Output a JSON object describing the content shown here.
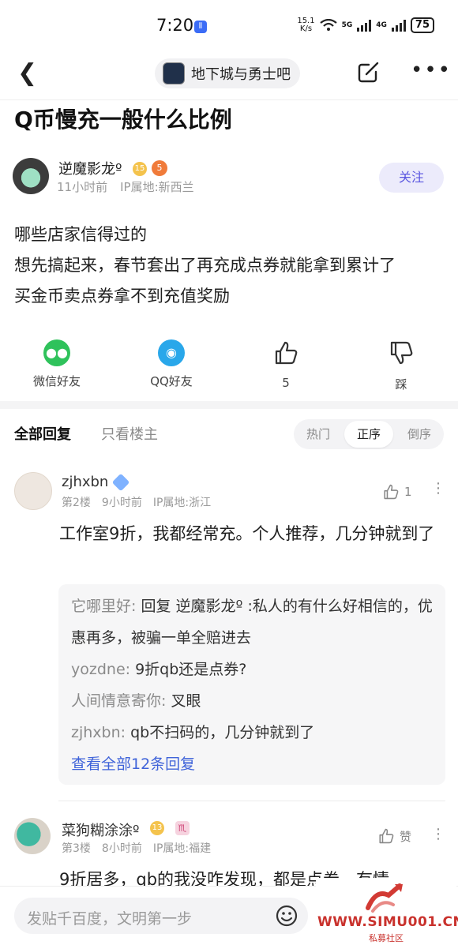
{
  "status_bar": {
    "time": "7:20",
    "net_speed_value": "15.1",
    "net_speed_unit": "K/s",
    "signal1": "5G",
    "signal2": "4G",
    "battery": "75"
  },
  "nav": {
    "forum_name": "地下城与勇士吧",
    "icons": [
      "back-icon",
      "share-icon",
      "more-icon"
    ]
  },
  "post": {
    "title": "Q币慢充一般什么比例",
    "author": "逆魔影龙º",
    "author_level": "15",
    "author_badge": "5",
    "time": "11小时前",
    "ip": "IP属地:新西兰",
    "follow_label": "关注",
    "body_lines": [
      "哪些店家信得过的",
      "想先搞起来，春节套出了再充成点券就能拿到累计了",
      "买金币卖点券拿不到充值奖励"
    ]
  },
  "actions": {
    "wechat": "微信好友",
    "qq": "QQ好友",
    "like_count": "5",
    "dislike": "踩"
  },
  "replies_header": {
    "tab_all": "全部回复",
    "tab_owner": "只看楼主",
    "sort_hot": "热门",
    "sort_asc": "正序",
    "sort_desc": "倒序",
    "active_sort": "正序"
  },
  "reply1": {
    "author": "zjhxbn",
    "floor": "第2楼",
    "time": "9小时前",
    "ip": "IP属地:浙江",
    "likes": "1",
    "text": "工作室9折，我都经常充。个人推荐，几分钟就到了",
    "sub_replies": [
      {
        "user": "它哪里好:",
        "text": "回复 逆魔影龙º :私人的有什么好相信的，优惠再多，被骗一单全赔进去"
      },
      {
        "user": "yozdne:",
        "text": "9折qb还是点券?"
      },
      {
        "user": "人间情意寄你:",
        "text": "叉眼"
      },
      {
        "user": "zjhxbn:",
        "text": "qb不扫码的，几分钟就到了"
      }
    ],
    "view_all": "查看全部12条回复"
  },
  "reply2": {
    "author": "菜狗糊涂涂º",
    "level": "13",
    "zodiac": "♏",
    "floor": "第3楼",
    "time": "8小时前",
    "ip": "IP属地:福建",
    "like_label": "赞",
    "text": "9折居多，qb的我没咋发现，都是点券，有情"
  },
  "bottom_bar": {
    "input_placeholder": "发贴千百度，文明第一步"
  },
  "watermark": {
    "url": "WWW.SIMU001.CN",
    "name": "私募社区"
  }
}
